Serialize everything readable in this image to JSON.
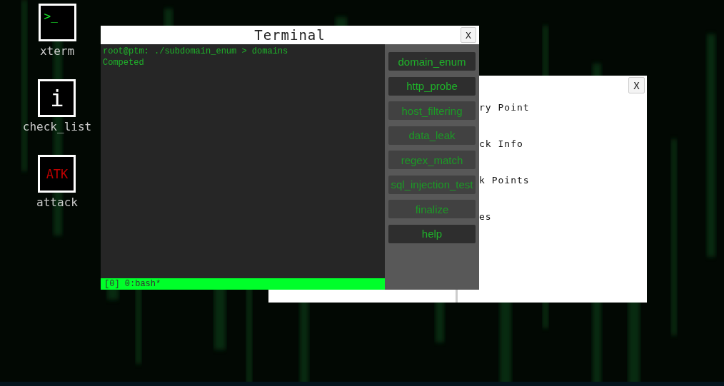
{
  "desktop_icons": [
    {
      "kind": "prompt",
      "glyph": ">_",
      "label": "xterm"
    },
    {
      "kind": "info",
      "glyph": "i",
      "label": "check_list"
    },
    {
      "kind": "attack",
      "glyph": "ATK",
      "label": "attack"
    }
  ],
  "back_window": {
    "close": "X",
    "items": [
      "ry Point",
      "ck Info",
      "k Points",
      "es"
    ]
  },
  "terminal": {
    "title": "Terminal",
    "close": "X",
    "lines": [
      "root@ptm: ./subdomain_enum > domains",
      "Competed"
    ],
    "status": "[0] 0:bash*",
    "tools": [
      {
        "label": "domain_enum",
        "disabled": false
      },
      {
        "label": "http_probe",
        "disabled": false
      },
      {
        "label": "host_filtering",
        "disabled": true
      },
      {
        "label": "data_leak",
        "disabled": true
      },
      {
        "label": "regex_match",
        "disabled": true
      },
      {
        "label": "sql_injection_test",
        "disabled": true
      },
      {
        "label": "finalize",
        "disabled": true
      },
      {
        "label": "help",
        "disabled": false
      }
    ]
  }
}
